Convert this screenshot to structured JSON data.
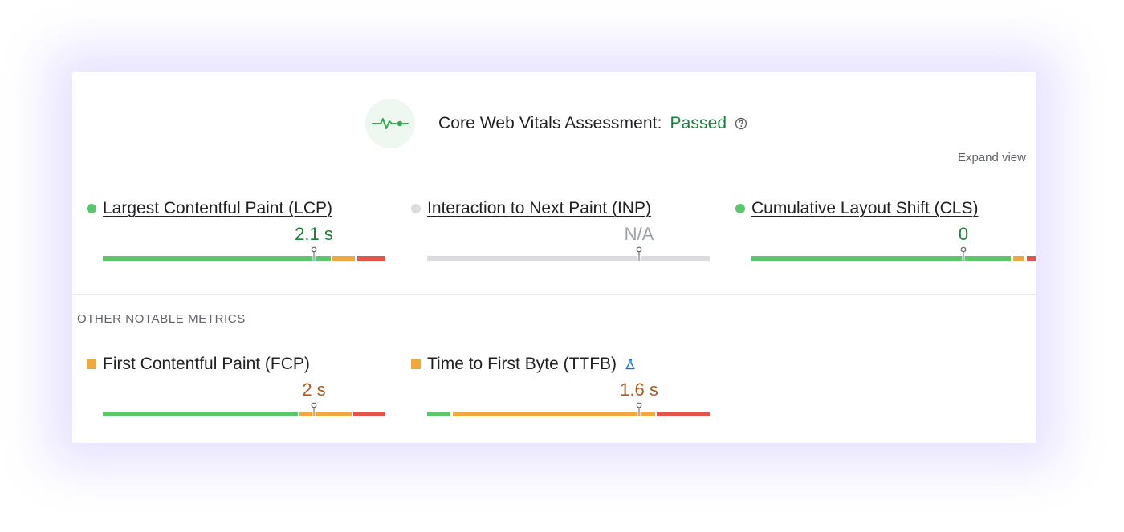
{
  "header": {
    "title": "Core Web Vitals Assessment:",
    "status": "Passed",
    "icon": "vital-pulse-icon",
    "help_icon": "help-circle-icon"
  },
  "expand_label": "Expand view",
  "colors": {
    "good": "#5cc66d",
    "needs_improvement": "#f2a93b",
    "poor": "#e5544b",
    "na": "#dadce0",
    "good_text": "#188038",
    "ni_text": "#b0591d",
    "na_text": "#9aa0a6"
  },
  "core_metrics": [
    {
      "label": "Largest Contentful Paint (LCP)",
      "value": "2.1 s",
      "rating": "good"
    },
    {
      "label": "Interaction to Next Paint (INP)",
      "value": "N/A",
      "rating": "na"
    },
    {
      "label": "Cumulative Layout Shift (CLS)",
      "value": "0",
      "rating": "good"
    }
  ],
  "other_section_title": "OTHER NOTABLE METRICS",
  "other_metrics": [
    {
      "label": "First Contentful Paint (FCP)",
      "value": "2 s",
      "rating": "needs_improvement"
    },
    {
      "label": "Time to First Byte (TTFB)",
      "value": "1.6 s",
      "rating": "needs_improvement",
      "badge_icon": "lab-flask-icon"
    }
  ]
}
